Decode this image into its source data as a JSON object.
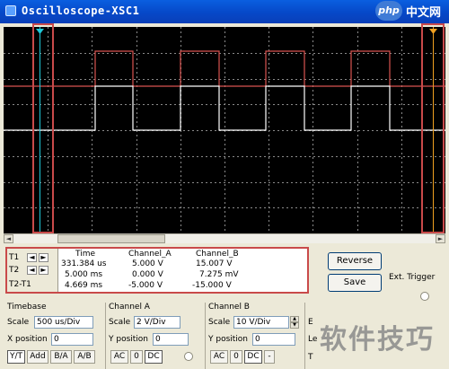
{
  "window": {
    "title": "Oscilloscope-XSC1"
  },
  "watermark": {
    "badge": "php",
    "text": "中文网",
    "footer": "软件技巧"
  },
  "readout": {
    "headers": [
      "Time",
      "Channel_A",
      "Channel_B"
    ],
    "rows": [
      {
        "label": "T1",
        "time": "331.384 us",
        "a": "5.000 V",
        "b": "15.007 V"
      },
      {
        "label": "T2",
        "time": "5.000 ms",
        "a": "0.000 V",
        "b": "7.275 mV"
      },
      {
        "label": "T2-T1",
        "time": "4.669 ms",
        "a": "-5.000 V",
        "b": "-15.000 V"
      }
    ],
    "arrow_left": "◄",
    "arrow_right": "►"
  },
  "buttons": {
    "reverse": "Reverse",
    "save": "Save",
    "ext_trigger": "Ext. Trigger"
  },
  "timebase": {
    "title": "Timebase",
    "scale_label": "Scale",
    "scale": "500 us/Div",
    "xpos_label": "X position",
    "xpos": "0",
    "modes": [
      "Y/T",
      "Add",
      "B/A",
      "A/B"
    ]
  },
  "channel_a": {
    "title": "Channel A",
    "scale_label": "Scale",
    "scale": "2 V/Div",
    "ypos_label": "Y position",
    "ypos": "0",
    "coupling": [
      "AC",
      "0",
      "DC"
    ]
  },
  "channel_b": {
    "title": "Channel B",
    "scale_label": "Scale",
    "scale": "10 V/Div",
    "ypos_label": "Y position",
    "ypos": "0",
    "coupling": [
      "AC",
      "0",
      "DC",
      "-"
    ]
  },
  "trigger_partial": {
    "e": "E",
    "le": "Le",
    "t": "T"
  },
  "colors": {
    "screen": "#000000",
    "channel_a": "#ffffff",
    "channel_b": "#d9534f",
    "cursor_1": "#1ec8d8",
    "cursor_2": "#f0a020",
    "highlight": "#c94a4a"
  }
}
